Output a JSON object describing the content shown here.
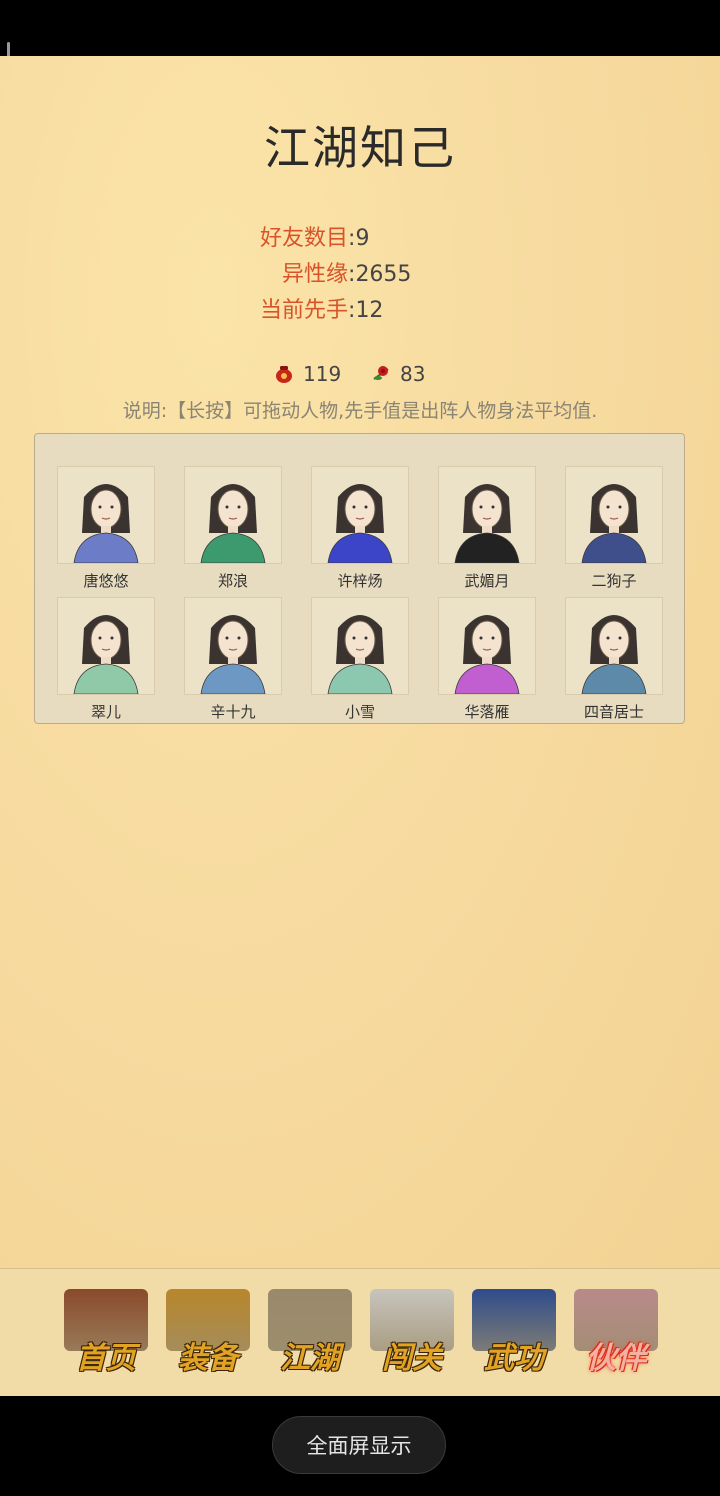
{
  "title": "江湖知己",
  "stats": [
    {
      "key": "好友数目",
      "value": "9"
    },
    {
      "key": "异性缘",
      "value": "2655"
    },
    {
      "key": "当前先手",
      "value": "12"
    }
  ],
  "currencies": [
    {
      "icon": "red-pouch-icon",
      "value": "119"
    },
    {
      "icon": "rose-icon",
      "value": "83"
    }
  ],
  "note": "说明:【长按】可拖动人物,先手值是出阵人物身法平均值.",
  "partners": [
    {
      "name": "唐悠悠",
      "robe": "#6c7cc6"
    },
    {
      "name": "郑浪",
      "robe": "#3d9a6e"
    },
    {
      "name": "许梓炀",
      "robe": "#3c45c8"
    },
    {
      "name": "武媚月",
      "robe": "#222222"
    },
    {
      "name": "二狗子",
      "robe": "#3f4f8c"
    },
    {
      "name": "翠儿",
      "robe": "#8fc9a8"
    },
    {
      "name": "辛十九",
      "robe": "#6e98c4"
    },
    {
      "name": "小雪",
      "robe": "#8cc7b0"
    },
    {
      "name": "华落雁",
      "robe": "#c15fd0"
    },
    {
      "name": "四音居士",
      "robe": "#5d8aa8"
    }
  ],
  "tabs": [
    {
      "label": "首页",
      "icon": "house-icon",
      "active": false
    },
    {
      "label": "装备",
      "icon": "armor-icon",
      "active": false
    },
    {
      "label": "江湖",
      "icon": "scroll-map-icon",
      "active": false
    },
    {
      "label": "闯关",
      "icon": "crossed-swords-icon",
      "active": false
    },
    {
      "label": "武功",
      "icon": "book-icon",
      "active": false
    },
    {
      "label": "伙伴",
      "icon": "partners-icon",
      "active": true
    }
  ],
  "system": {
    "fullscreen_label": "全面屏显示"
  }
}
